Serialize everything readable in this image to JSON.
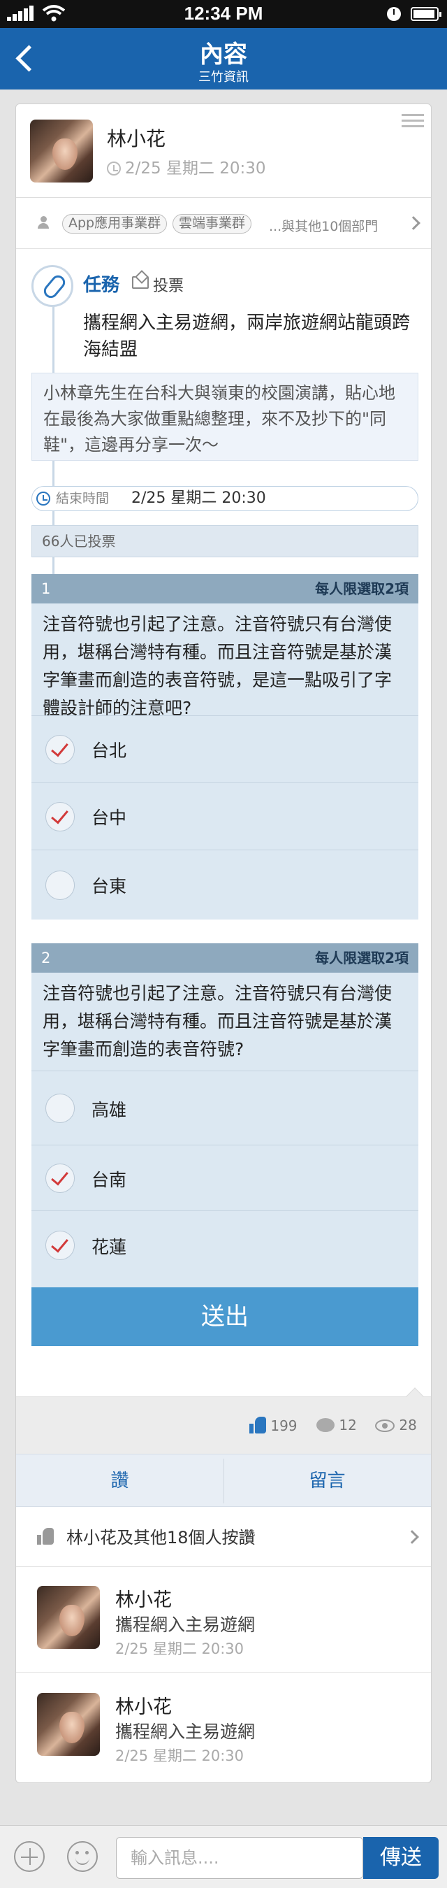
{
  "status_bar": {
    "time": "12:34 PM"
  },
  "nav": {
    "title": "內容",
    "subtitle": "三竹資訊"
  },
  "post": {
    "author": "林小花",
    "time": "2/25 星期二 20:30",
    "tags": [
      "App應用事業群",
      "雲端事業群"
    ],
    "more_depts": "...與其他10個部門",
    "type_label": "任務",
    "vote_label": "投票",
    "title": "攜程網入主易遊網，兩岸旅遊網站龍頭跨海結盟",
    "description": "小林章先生在台科大與嶺東的校園演講，貼心地在最後為大家做重點總整理，來不及抄下的\"同鞋\"，這邊再分享一次～",
    "end_time_label": "結束時間",
    "end_time_value": "2/25 星期二 20:30",
    "voted_count": "66人已投票"
  },
  "questions": [
    {
      "number": "1",
      "limit": "每人限選取2項",
      "text": "注音符號也引起了注意。注音符號只有台灣使用，堪稱台灣特有種。而且注音符號是基於漢字筆畫而創造的表音符號，是這一點吸引了字體設計師的注意吧?",
      "options": [
        {
          "label": "台北",
          "checked": true
        },
        {
          "label": "台中",
          "checked": true
        },
        {
          "label": "台東",
          "checked": false
        }
      ]
    },
    {
      "number": "2",
      "limit": "每人限選取2項",
      "text": "注音符號也引起了注意。注音符號只有台灣使用，堪稱台灣特有種。而且注音符號是基於漢字筆畫而創造的表音符號?",
      "options": [
        {
          "label": "高雄",
          "checked": false
        },
        {
          "label": "台南",
          "checked": true
        },
        {
          "label": "花蓮",
          "checked": true
        }
      ]
    }
  ],
  "submit_label": "送出",
  "stats": {
    "likes": "199",
    "comments": "12",
    "views": "28"
  },
  "actions": {
    "like": "讚",
    "comment": "留言"
  },
  "likers_text": "林小花及其他18個人按讚",
  "comments": [
    {
      "name": "林小花",
      "text": "攜程網入主易遊網",
      "time": "2/25 星期二 20:30"
    },
    {
      "name": "林小花",
      "text": "攜程網入主易遊網",
      "time": "2/25 星期二 20:30"
    }
  ],
  "input": {
    "placeholder": "輸入訊息....",
    "send_label": "傳送"
  },
  "colors": {
    "brand_blue": "#1a64ad",
    "submit_blue": "#4a9ad0",
    "check_red": "#d23a3a"
  }
}
